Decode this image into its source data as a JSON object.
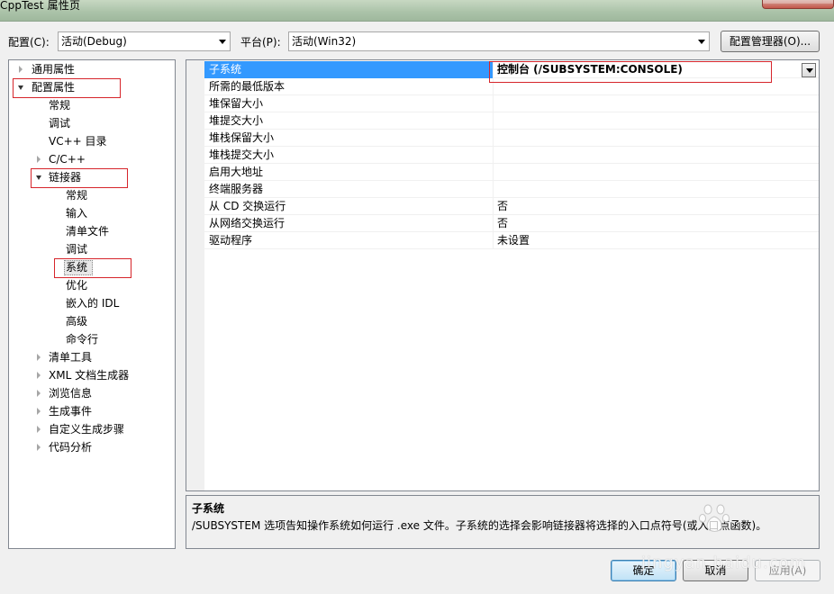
{
  "window": {
    "title": "CppTest 属性页"
  },
  "config_bar": {
    "config_label": "配置(C):",
    "config_value": "活动(Debug)",
    "platform_label": "平台(P):",
    "platform_value": "活动(Win32)",
    "manager_button": "配置管理器(O)..."
  },
  "tree": {
    "items": [
      {
        "label": "通用属性",
        "level": 0,
        "state": "collapsed"
      },
      {
        "label": "配置属性",
        "level": 0,
        "state": "expanded",
        "highlighted": true
      },
      {
        "label": "常规",
        "level": 1,
        "state": "leaf"
      },
      {
        "label": "调试",
        "level": 1,
        "state": "leaf"
      },
      {
        "label": "VC++ 目录",
        "level": 1,
        "state": "leaf"
      },
      {
        "label": "C/C++",
        "level": 1,
        "state": "collapsed"
      },
      {
        "label": "链接器",
        "level": 1,
        "state": "expanded",
        "highlighted": true
      },
      {
        "label": "常规",
        "level": 2,
        "state": "leaf"
      },
      {
        "label": "输入",
        "level": 2,
        "state": "leaf"
      },
      {
        "label": "清单文件",
        "level": 2,
        "state": "leaf"
      },
      {
        "label": "调试",
        "level": 2,
        "state": "leaf"
      },
      {
        "label": "系统",
        "level": 2,
        "state": "leaf",
        "selected": true,
        "highlighted": true
      },
      {
        "label": "优化",
        "level": 2,
        "state": "leaf"
      },
      {
        "label": "嵌入的 IDL",
        "level": 2,
        "state": "leaf"
      },
      {
        "label": "高级",
        "level": 2,
        "state": "leaf"
      },
      {
        "label": "命令行",
        "level": 2,
        "state": "leaf"
      },
      {
        "label": "清单工具",
        "level": 1,
        "state": "collapsed"
      },
      {
        "label": "XML 文档生成器",
        "level": 1,
        "state": "collapsed"
      },
      {
        "label": "浏览信息",
        "level": 1,
        "state": "collapsed"
      },
      {
        "label": "生成事件",
        "level": 1,
        "state": "collapsed"
      },
      {
        "label": "自定义生成步骤",
        "level": 1,
        "state": "collapsed"
      },
      {
        "label": "代码分析",
        "level": 1,
        "state": "collapsed"
      }
    ]
  },
  "properties": {
    "rows": [
      {
        "name": "子系统",
        "value": "控制台 (/SUBSYSTEM:CONSOLE)",
        "selected": true
      },
      {
        "name": "所需的最低版本",
        "value": ""
      },
      {
        "name": "堆保留大小",
        "value": ""
      },
      {
        "name": "堆提交大小",
        "value": ""
      },
      {
        "name": "堆栈保留大小",
        "value": ""
      },
      {
        "name": "堆栈提交大小",
        "value": ""
      },
      {
        "name": "启用大地址",
        "value": ""
      },
      {
        "name": "终端服务器",
        "value": ""
      },
      {
        "name": "从 CD 交换运行",
        "value": "否"
      },
      {
        "name": "从网络交换运行",
        "value": "否"
      },
      {
        "name": "驱动程序",
        "value": "未设置"
      }
    ]
  },
  "description": {
    "title": "子系统",
    "text": "/SUBSYSTEM 选项告知操作系统如何运行 .exe 文件。子系统的选择会影响链接器将选择的入口点符号(或入口点函数)。"
  },
  "buttons": {
    "ok": "确定",
    "cancel": "取消",
    "apply": "应用(A)"
  },
  "watermark": {
    "text": "jingyan.baidu.com"
  },
  "colors": {
    "selection": "#3399ff",
    "highlight_box": "#d6252b"
  }
}
